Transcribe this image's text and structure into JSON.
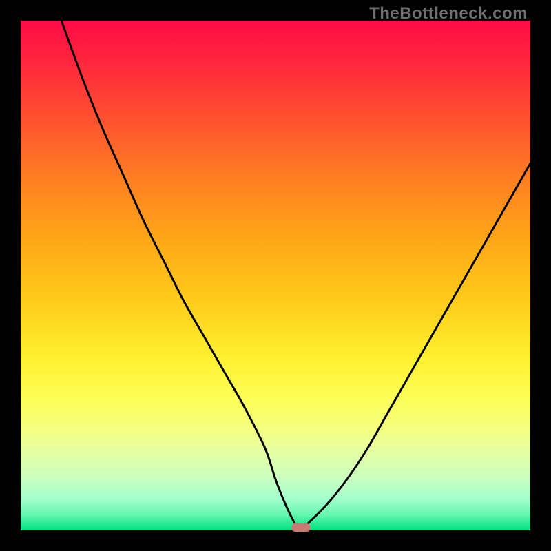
{
  "attribution": "TheBottleneck.com",
  "colors": {
    "frame": "#000000",
    "curve": "#000000",
    "marker": "#cb7a73"
  },
  "chart_data": {
    "type": "line",
    "title": "",
    "xlabel": "",
    "ylabel": "",
    "xlim": [
      0,
      100
    ],
    "ylim": [
      0,
      100
    ],
    "x": [
      8,
      12,
      16,
      20,
      24,
      28,
      32,
      36,
      40,
      44,
      48,
      50,
      52,
      54,
      55,
      56,
      60,
      64,
      68,
      72,
      76,
      80,
      84,
      88,
      92,
      96,
      100
    ],
    "values": [
      100,
      89,
      79,
      70,
      61,
      53,
      45,
      38,
      31,
      24,
      16,
      10,
      5,
      1,
      0,
      1,
      5,
      10,
      16,
      23,
      30,
      37,
      44,
      51,
      58,
      65,
      72
    ],
    "notch_x": 55,
    "marker": {
      "x": 55,
      "y": 0
    },
    "background_gradient": {
      "top": "#ff0b46",
      "bottom": "#00e07e"
    }
  }
}
